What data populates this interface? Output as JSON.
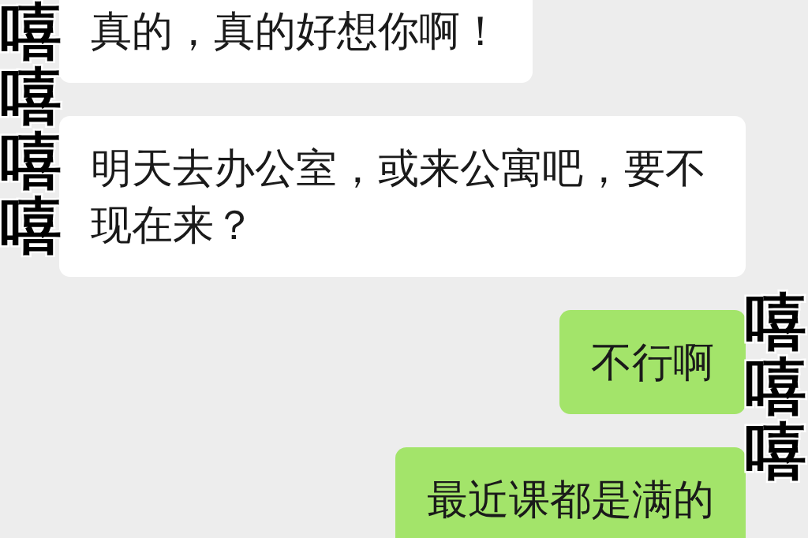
{
  "messages": [
    {
      "kind": "received",
      "text": "真的，真的好想你啊！"
    },
    {
      "kind": "received",
      "text": "明天去办公室，或来公寓吧，要不现在来？"
    },
    {
      "kind": "sent",
      "text": "不行啊"
    },
    {
      "kind": "sent",
      "text": "最近课都是满的"
    }
  ],
  "stickers": [
    {
      "kind": "left",
      "text": "嘻嘻嘻嘻"
    },
    {
      "kind": "right",
      "text": "嘻嘻嘻"
    }
  ]
}
